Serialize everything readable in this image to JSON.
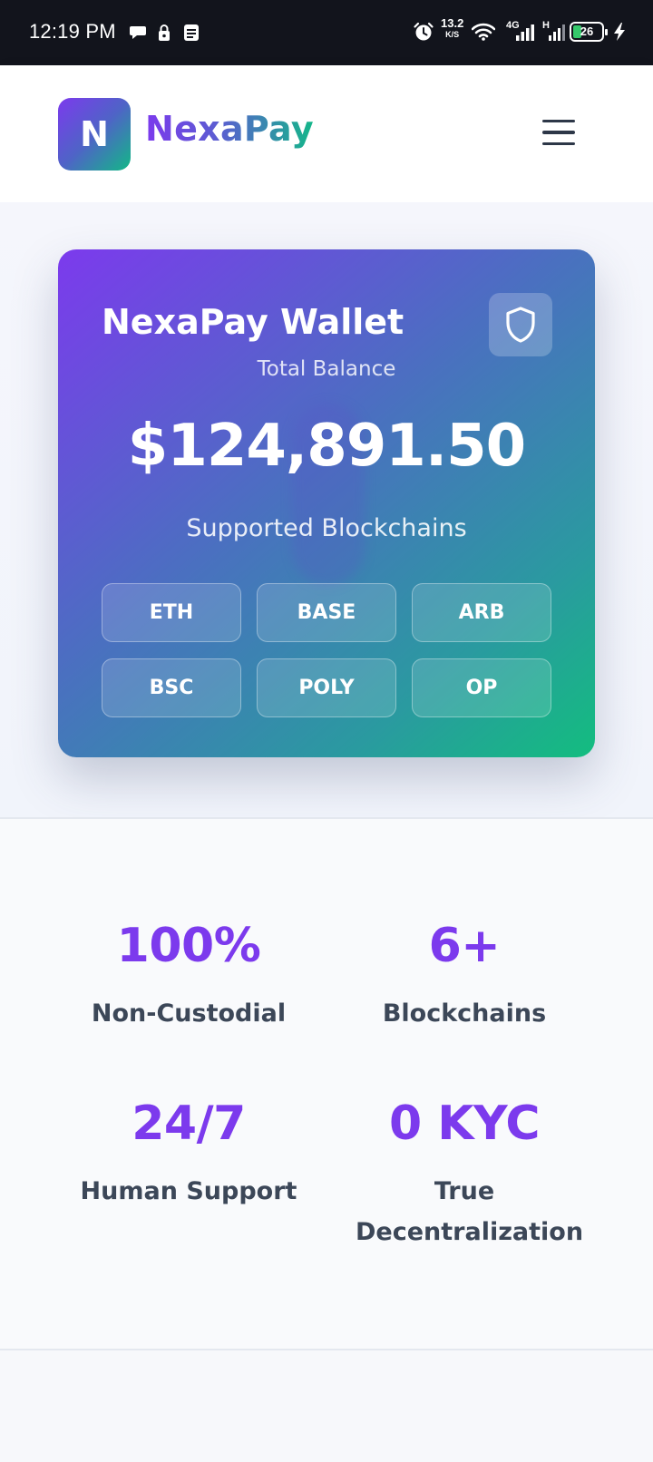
{
  "status_bar": {
    "time": "12:19 PM",
    "net_speed_value": "13.2",
    "net_speed_unit": "K/S",
    "network_4g": "4G",
    "network_h": "H",
    "battery_level": "26"
  },
  "header": {
    "logo_letter": "N",
    "brand_name": "NexaPay",
    "menu_icon": "hamburger-menu-icon"
  },
  "wallet": {
    "title": "NexaPay Wallet",
    "balance_label": "Total Balance",
    "balance": "$124,891.50",
    "supported_label": "Supported Blockchains",
    "chains": [
      "ETH",
      "BASE",
      "ARB",
      "BSC",
      "POLY",
      "OP"
    ],
    "shield_icon": "shield-icon"
  },
  "stats": [
    {
      "value": "100%",
      "label": "Non-Custodial"
    },
    {
      "value": "6+",
      "label": "Blockchains"
    },
    {
      "value": "24/7",
      "label": "Human Support"
    },
    {
      "value": "0 KYC",
      "label": "True Decentralization"
    }
  ],
  "colors": {
    "accent_purple": "#7c3aed",
    "accent_green": "#13bd7f",
    "text_dark": "#2d3748"
  }
}
